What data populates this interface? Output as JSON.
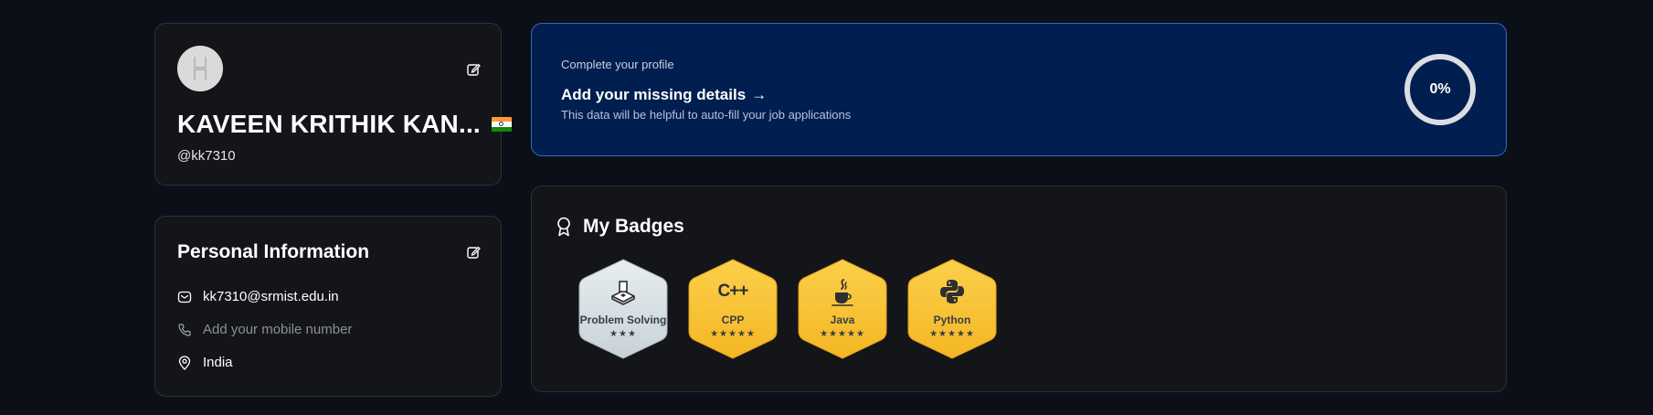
{
  "profile": {
    "name": "KAVEEN KRITHIK KAN...",
    "username": "@kk7310",
    "flag": "India flag"
  },
  "personal_info": {
    "title": "Personal Information",
    "email": "kk7310@srmist.edu.in",
    "phone_placeholder": "Add your mobile number",
    "country": "India"
  },
  "complete_profile": {
    "label": "Complete your profile",
    "title": "Add your missing details",
    "arrow": "→",
    "description": "This data will be helpful to auto-fill your job applications",
    "progress_text": "0%",
    "progress_value": 0
  },
  "badges": {
    "title": "My Badges",
    "items": [
      {
        "name": "Problem Solving",
        "stars": "★★★",
        "icon": "problem-solving-icon",
        "color": "silver"
      },
      {
        "name": "CPP",
        "stars": "★★★★★",
        "icon_text": "C++",
        "icon": "cpp-icon",
        "color": "gold"
      },
      {
        "name": "Java",
        "stars": "★★★★★",
        "icon": "java-icon",
        "color": "gold"
      },
      {
        "name": "Python",
        "stars": "★★★★★",
        "icon": "python-icon",
        "color": "gold"
      }
    ]
  },
  "colors": {
    "background": "#0b0f18",
    "card": "#141519",
    "accent_card": "#001e4f",
    "gold_badge": "#f7c12f",
    "silver_badge": "#dfe6ea"
  }
}
